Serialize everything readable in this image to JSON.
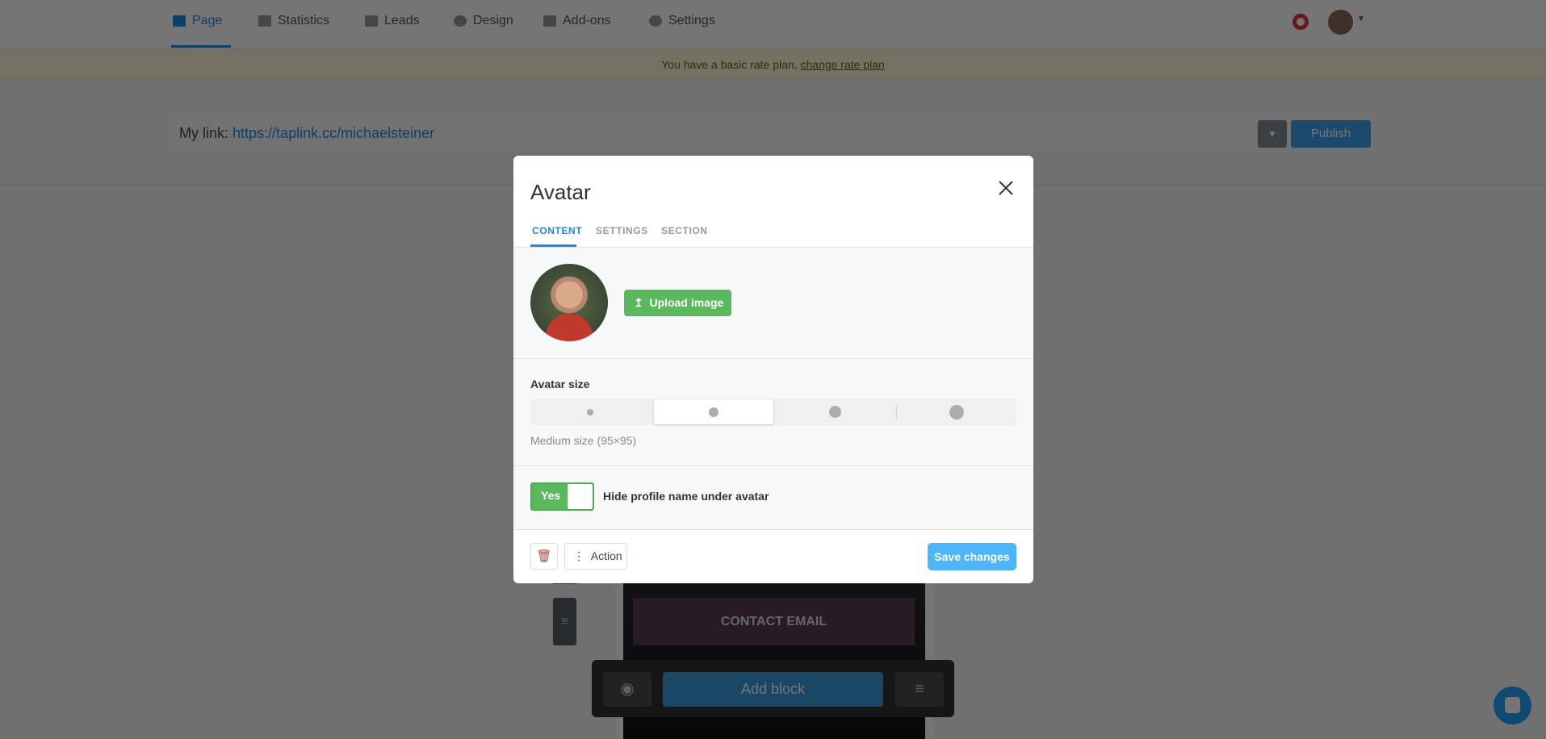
{
  "nav": {
    "items": [
      {
        "label": "Page",
        "icon": "page-icon",
        "active": true
      },
      {
        "label": "Statistics",
        "icon": "bar-chart-icon"
      },
      {
        "label": "Leads",
        "icon": "card-icon"
      },
      {
        "label": "Design",
        "icon": "palette-icon"
      },
      {
        "label": "Add-ons",
        "icon": "puzzle-icon"
      },
      {
        "label": "Settings",
        "icon": "gear-icon"
      }
    ],
    "help_icon": "lifebuoy-icon",
    "accent": "#1e88e5"
  },
  "banner": {
    "text": "You have a basic rate plan,",
    "link": "change rate plan"
  },
  "linkbar": {
    "label": "My link:",
    "url": "https://taplink.cc/michaelsteiner",
    "publish": "Publish"
  },
  "preview": {
    "contact_button": "CONTACT EMAIL",
    "add_block": "Add block"
  },
  "modal": {
    "title": "Avatar",
    "tabs": [
      {
        "label": "CONTENT",
        "active": true
      },
      {
        "label": "SETTINGS"
      },
      {
        "label": "SECTION"
      }
    ],
    "upload_label": "Upload image",
    "size_label": "Avatar size",
    "size_options": [
      "small",
      "medium",
      "large",
      "extra-large"
    ],
    "size_selected": "medium",
    "size_description": "Medium size (95×95)",
    "toggle": {
      "value": "Yes",
      "on": true,
      "label": "Hide profile name under avatar"
    },
    "action_label": "Action",
    "save_label": "Save changes"
  }
}
